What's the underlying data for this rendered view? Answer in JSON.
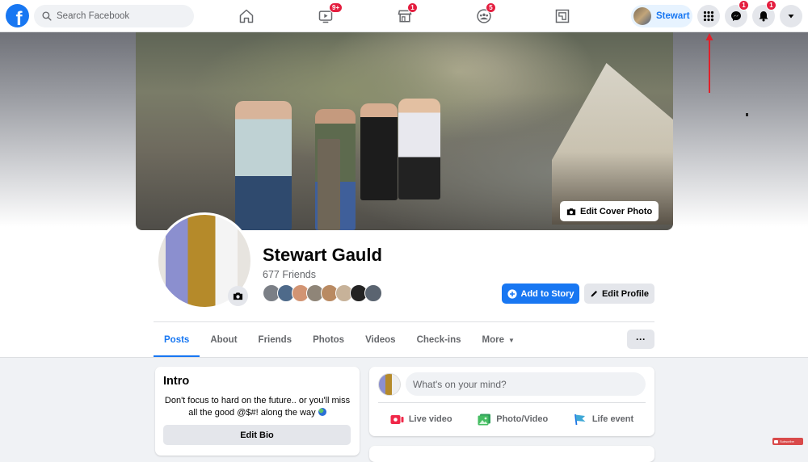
{
  "topbar": {
    "logo": "f",
    "search_placeholder": "Search Facebook",
    "nav": [
      {
        "name": "home",
        "icon": "home-icon",
        "badge": null
      },
      {
        "name": "watch",
        "icon": "video-icon",
        "badge": "9+"
      },
      {
        "name": "marketplace",
        "icon": "shop-icon",
        "badge": "1"
      },
      {
        "name": "groups",
        "icon": "groups-icon",
        "badge": "5"
      },
      {
        "name": "gaming",
        "icon": "gaming-icon",
        "badge": null
      }
    ],
    "profile_name": "Stewart",
    "menu_icon": "grid-menu-icon",
    "messenger_badge": "1",
    "notifications_badge": "1",
    "account_icon": "caret-down-icon"
  },
  "cover": {
    "edit_label": "Edit Cover Photo"
  },
  "profile": {
    "name": "Stewart Gauld",
    "friends_count": "677 Friends",
    "friend_avatars": 8,
    "add_story_label": "Add to Story",
    "edit_profile_label": "Edit Profile"
  },
  "tabs": {
    "items": [
      "Posts",
      "About",
      "Friends",
      "Photos",
      "Videos",
      "Check-ins",
      "More"
    ],
    "active": "Posts",
    "more_menu_label": "···"
  },
  "intro": {
    "title": "Intro",
    "bio": "Don't focus to hard on the future.. or you'll miss all the good @$#! along the way",
    "edit_bio_label": "Edit Bio"
  },
  "composer": {
    "placeholder": "What's on your mind?",
    "actions": [
      "Live video",
      "Photo/Video",
      "Life event"
    ]
  },
  "overlay": {
    "subscribe_label": "Subscribe"
  },
  "colors": {
    "brand": "#1877f2",
    "badge": "#e41e3f",
    "arrow": "#e0202a"
  }
}
